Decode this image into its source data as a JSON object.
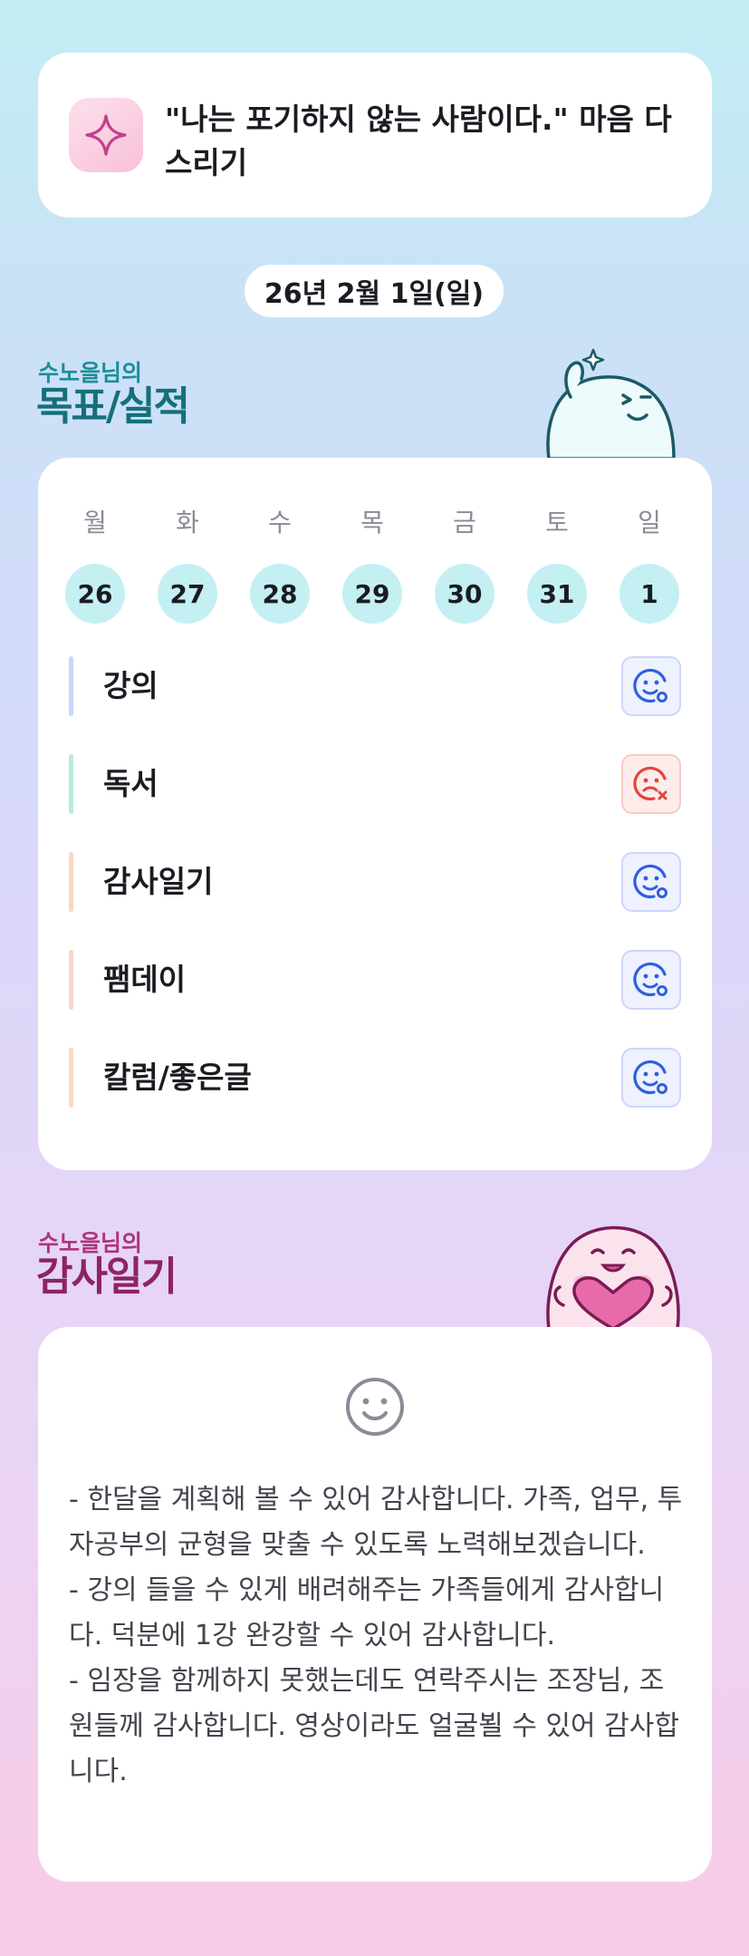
{
  "quote": {
    "text": "\"나는 포기하지 않는 사람이다.\" 마음 다스리기",
    "icon": "sparkle-icon"
  },
  "date_label": "26년 2월 1일(일)",
  "goals_section": {
    "subtitle": "수노을님의",
    "title": "목표/실적",
    "week": [
      {
        "day": "월",
        "date": "26"
      },
      {
        "day": "화",
        "date": "27"
      },
      {
        "day": "수",
        "date": "28"
      },
      {
        "day": "목",
        "date": "29"
      },
      {
        "day": "금",
        "date": "30"
      },
      {
        "day": "토",
        "date": "31"
      },
      {
        "day": "일",
        "date": "1"
      }
    ],
    "items": [
      {
        "label": "강의",
        "status": "done",
        "bar_color": "#c9d6fb"
      },
      {
        "label": "독서",
        "status": "fail",
        "bar_color": "#b6ecd9"
      },
      {
        "label": "감사일기",
        "status": "done",
        "bar_color": "#fbd7bf"
      },
      {
        "label": "팸데이",
        "status": "done",
        "bar_color": "#fbd3cd"
      },
      {
        "label": "칼럼/좋은글",
        "status": "done",
        "bar_color": "#fcd9c2"
      }
    ]
  },
  "gratitude_section": {
    "subtitle": "수노을님의",
    "title": "감사일기",
    "mood_icon": "smile-face-icon",
    "text": "- 한달을 계획해 볼 수 있어 감사합니다. 가족, 업무, 투자공부의 균형을 맞출 수 있도록 노력해보겠습니다.\n- 강의 들을 수 있게 배려해주는 가족들에게 감사합니다. 덕분에 1강 완강할 수 있어 감사합니다.\n- 임장을 함께하지 못했는데도 연락주시는 조장님, 조원들께 감사합니다. 영상이라도 얼굴뵐 수 있어 감사합니다."
  },
  "colors": {
    "accent_teal": "#14707a",
    "accent_magenta": "#8e2266",
    "done_blue": "#2f5fe0",
    "fail_red": "#e0473a",
    "date_circle": "#c4f0f3"
  }
}
